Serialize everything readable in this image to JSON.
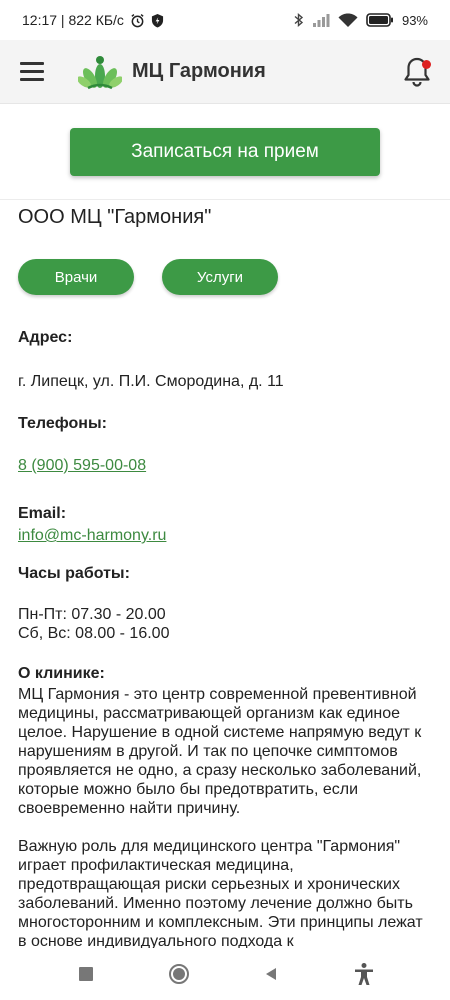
{
  "status_bar": {
    "time_speed": "12:17 | 822 КБ/с",
    "battery": "93%"
  },
  "app_bar": {
    "title": "МЦ Гармония"
  },
  "appointment_button": "Записаться на прием",
  "org_name": "ООО МЦ \"Гармония\"",
  "pills": {
    "doctors": "Врачи",
    "services": "Услуги"
  },
  "address": {
    "label": "Адрес:",
    "value": "г. Липецк, ул. П.И. Смородина, д. 11"
  },
  "phones": {
    "label": "Телефоны:",
    "value": "8 (900) 595-00-08"
  },
  "email": {
    "label": "Email:",
    "value": "info@mc-harmony.ru"
  },
  "hours": {
    "label": "Часы работы:",
    "weekdays": "Пн-Пт:  07.30 - 20.00",
    "weekend": "Сб, Вс: 08.00 - 16.00"
  },
  "about": {
    "label": "О клинике:",
    "paragraph1": "МЦ Гармония - это центр современной превентивной медицины, рассматривающей организм как единое целое. Нарушение в одной системе напрямую ведут к нарушениям в другой. И так по цепочке симптомов проявляется не одно, а сразу несколько заболеваний, которые можно было бы предотвратить, если своевременно найти причину.",
    "paragraph2": "Важную роль для медицинского центра \"Гармония\" играет профилактическая медицина, предотвращающая риски серьезных и хронических заболеваний. Именно поэтому лечение должно быть многосторонним и комплексным. Эти принципы лежат в основе индивидуального подхода к"
  },
  "colors": {
    "brand_green": "#3d9a46",
    "link_green": "#3d8a40",
    "notification_dot": "#dd2222"
  }
}
